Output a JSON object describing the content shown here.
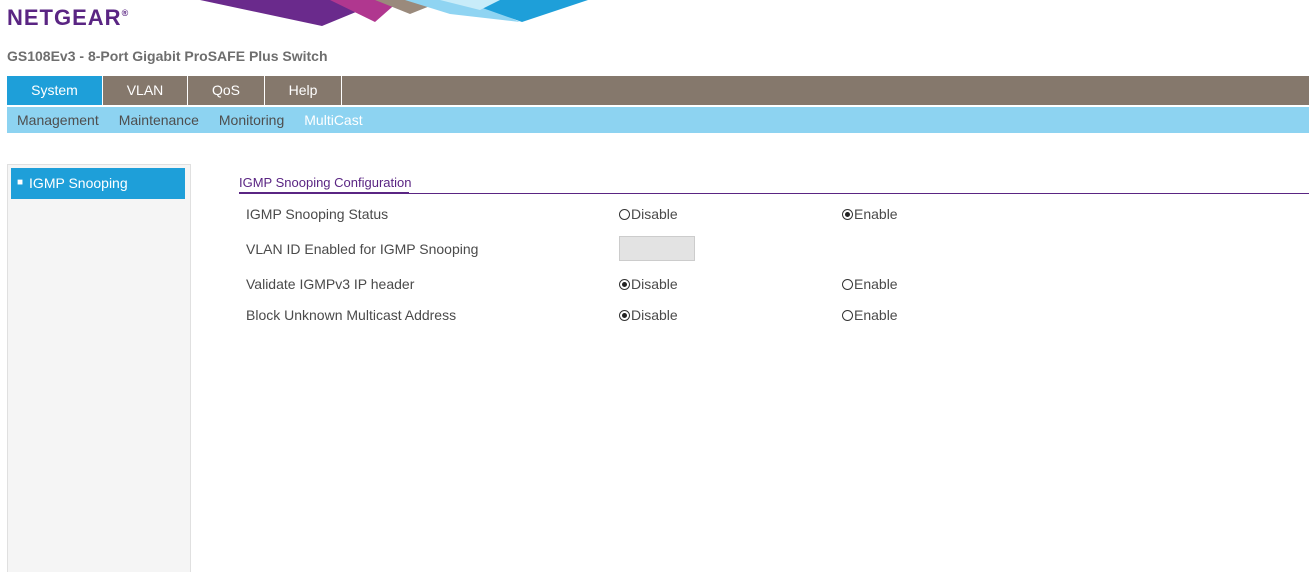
{
  "brand": {
    "logo": "NETGEAR",
    "registered": "®",
    "logo_color": "#5a2583"
  },
  "device": {
    "title": "GS108Ev3 - 8-Port Gigabit ProSAFE Plus Switch"
  },
  "main_nav": {
    "tabs": [
      {
        "label": "System",
        "active": true
      },
      {
        "label": "VLAN",
        "active": false
      },
      {
        "label": "QoS",
        "active": false
      },
      {
        "label": "Help",
        "active": false
      }
    ],
    "bar_color": "#85786c",
    "active_color": "#1e9fd9"
  },
  "sub_nav": {
    "items": [
      {
        "label": "Management",
        "active": false
      },
      {
        "label": "Maintenance",
        "active": false
      },
      {
        "label": "Monitoring",
        "active": false
      },
      {
        "label": "MultiCast",
        "active": true
      }
    ],
    "bar_color": "#8dd3f1"
  },
  "sidebar": {
    "items": [
      {
        "label": "IGMP Snooping",
        "active": true
      }
    ]
  },
  "content": {
    "section_title": "IGMP Snooping Configuration",
    "rows": [
      {
        "label": "IGMP Snooping Status",
        "options": [
          "Disable",
          "Enable"
        ],
        "selected": "Enable"
      },
      {
        "label": "VLAN ID Enabled for IGMP Snooping",
        "value": ""
      },
      {
        "label": "Validate IGMPv3 IP header",
        "options": [
          "Disable",
          "Enable"
        ],
        "selected": "Disable"
      },
      {
        "label": "Block Unknown Multicast Address",
        "options": [
          "Disable",
          "Enable"
        ],
        "selected": "Disable"
      }
    ]
  }
}
